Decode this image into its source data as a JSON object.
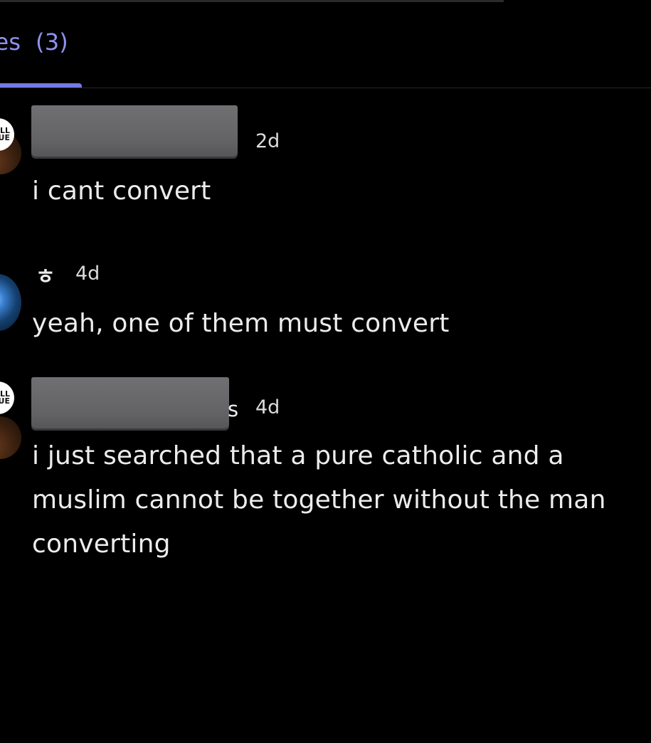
{
  "tab": {
    "label": "ges",
    "count": "(3)",
    "accent": "#7579e8"
  },
  "messages": [
    {
      "username_redacted": true,
      "avatar": "brown-badge-avatar",
      "avatar_badge_text": "LL\nUE",
      "timestamp": "2d",
      "text": "i cant convert"
    },
    {
      "username": "ㅎ",
      "avatar": "blue-earth-avatar",
      "timestamp": "4d",
      "text": "yeah, one of them must convert"
    },
    {
      "username_redacted": true,
      "username_tail": "s",
      "avatar": "brown-badge-avatar",
      "avatar_badge_text": "LL\nUE",
      "timestamp": "4d",
      "text": "i just searched that a pure catholic and a muslim cannot be together without the man converting"
    }
  ]
}
